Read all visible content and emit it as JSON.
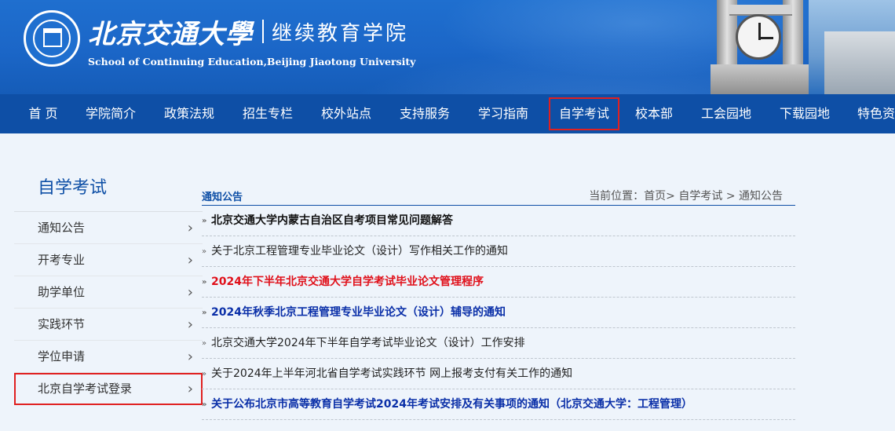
{
  "header": {
    "university_name": "北京交通大學",
    "department": "继续教育学院",
    "english_name": "School of Continuing Education,Beijing Jiaotong University"
  },
  "nav": {
    "items": [
      {
        "label": "首 页"
      },
      {
        "label": "学院简介"
      },
      {
        "label": "政策法规"
      },
      {
        "label": "招生专栏"
      },
      {
        "label": "校外站点"
      },
      {
        "label": "支持服务"
      },
      {
        "label": "学习指南"
      },
      {
        "label": "自学考试",
        "active": true
      },
      {
        "label": "校本部"
      },
      {
        "label": "工会园地"
      },
      {
        "label": "下载园地"
      },
      {
        "label": "特色资"
      }
    ]
  },
  "sidebar": {
    "title": "自学考试",
    "items": [
      {
        "label": "通知公告"
      },
      {
        "label": "开考专业"
      },
      {
        "label": "助学单位"
      },
      {
        "label": "实践环节"
      },
      {
        "label": "学位申请"
      },
      {
        "label": "北京自学考试登录",
        "highlighted": true
      }
    ],
    "chevron": "›"
  },
  "content": {
    "section_title": "通知公告",
    "breadcrumb": "当前位置：首页> 自学考试 > 通知公告",
    "bullet": "»",
    "news": [
      {
        "title": "北京交通大学内蒙古自治区自考项目常见问题解答",
        "style": "bold"
      },
      {
        "title": "关于北京工程管理专业毕业论文（设计）写作相关工作的通知",
        "style": "normal"
      },
      {
        "title": "2024年下半年北京交通大学自学考试毕业论文管理程序",
        "style": "red"
      },
      {
        "title": "2024年秋季北京工程管理专业毕业论文（设计）辅导的通知",
        "style": "blue"
      },
      {
        "title": "北京交通大学2024年下半年自学考试毕业论文（设计）工作安排",
        "style": "normal"
      },
      {
        "title": "关于2024年上半年河北省自学考试实践环节 网上报考支付有关工作的通知",
        "style": "normal"
      },
      {
        "title": "关于公布北京市高等教育自学考试2024年考试安排及有关事项的通知（北京交通大学：工程管理）",
        "style": "blue"
      }
    ]
  },
  "colors": {
    "header_blue": "#1f6fcf",
    "nav_blue": "#0e4fa6",
    "highlight_red": "#e02020",
    "news_red": "#e0101a",
    "news_blue": "#0a2fa8"
  }
}
